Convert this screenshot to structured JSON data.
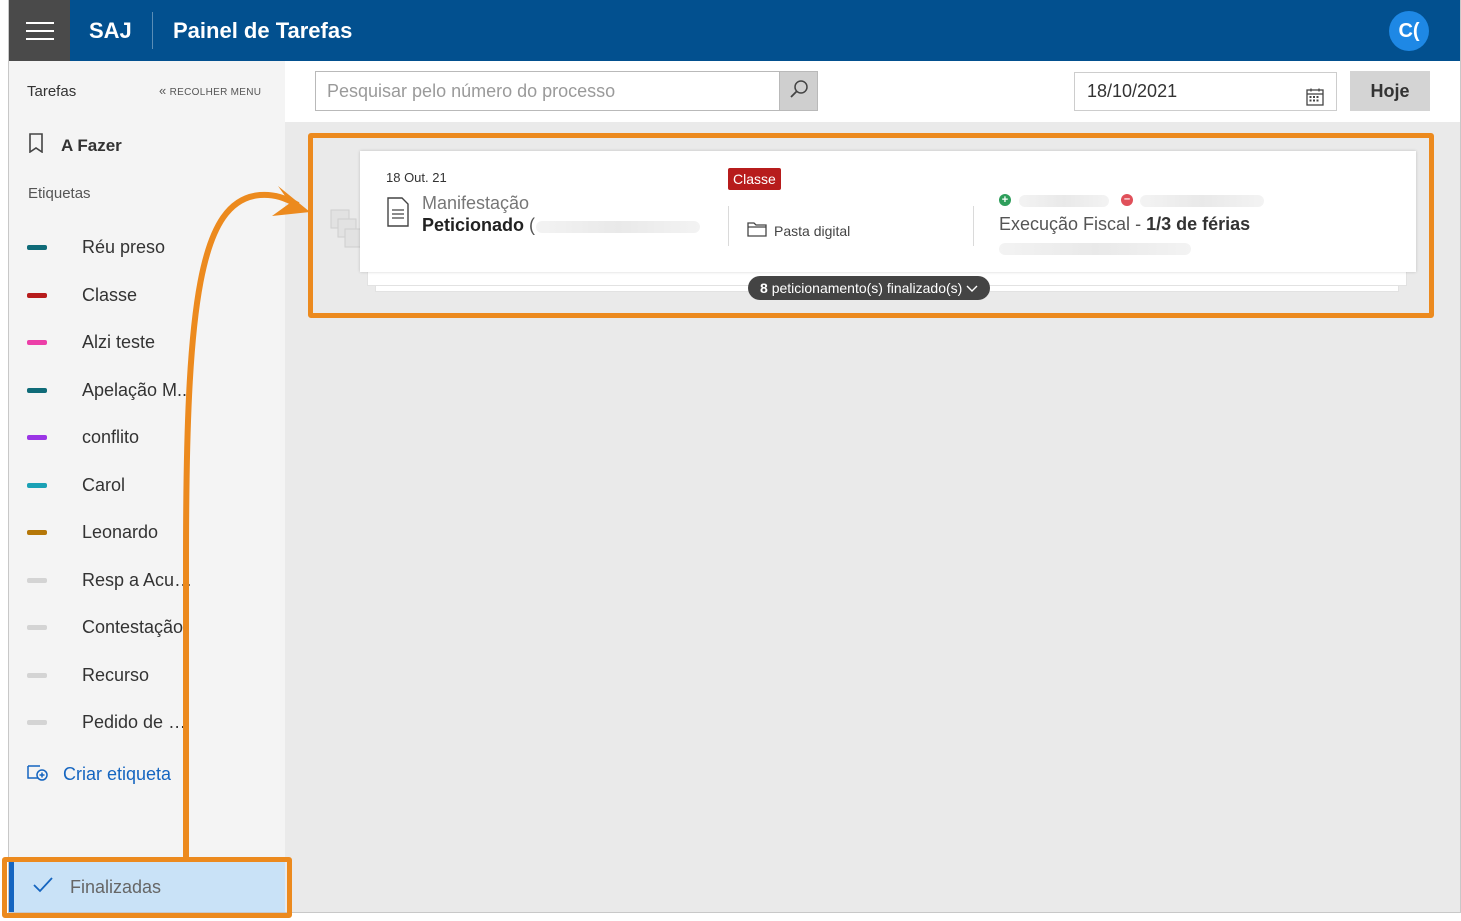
{
  "header": {
    "brand": "SAJ",
    "title": "Painel de Tarefas",
    "avatar_initials": "C(",
    "color": "#02508f"
  },
  "sidebar": {
    "title": "Tarefas",
    "collapse_label": "RECOLHER MENU",
    "todo_label": "A Fazer",
    "tags_heading": "Etiquetas",
    "tags": [
      {
        "label": "Réu preso",
        "color": "#0f6b78"
      },
      {
        "label": "Classe",
        "color": "#b71c1c"
      },
      {
        "label": "Alzi teste",
        "color": "#ec3fa8"
      },
      {
        "label": "Apelação M...",
        "color": "#0f6b78"
      },
      {
        "label": "conflito",
        "color": "#9b35e5"
      },
      {
        "label": "Carol",
        "color": "#1aa1b5"
      },
      {
        "label": "Leonardo",
        "color": "#b57708"
      },
      {
        "label": "Resp a Acus...",
        "color": "#d4d4d4"
      },
      {
        "label": "Contestação",
        "color": "#d4d4d4"
      },
      {
        "label": "Recurso",
        "color": "#d4d4d4"
      },
      {
        "label": "Pedido de Li...",
        "color": "#d4d4d4"
      }
    ],
    "create_label": "Criar etiqueta",
    "finalizadas_label": "Finalizadas"
  },
  "toolbar": {
    "search_placeholder": "Pesquisar pelo número do processo",
    "date_value": "18/10/2021",
    "today_label": "Hoje"
  },
  "card": {
    "date": "18 Out. 21",
    "type": "Manifestação",
    "status": "Peticionado",
    "status_paren": "(",
    "badge": "Classe",
    "folder_label": "Pasta digital",
    "topic_prefix": "Execução Fiscal",
    "topic_sep": " - ",
    "topic_bold": "1/3 de férias",
    "finished_count": "8",
    "finished_label": "peticionamento(s) finalizado(s)"
  },
  "annotation_color": "#ec8a1e"
}
